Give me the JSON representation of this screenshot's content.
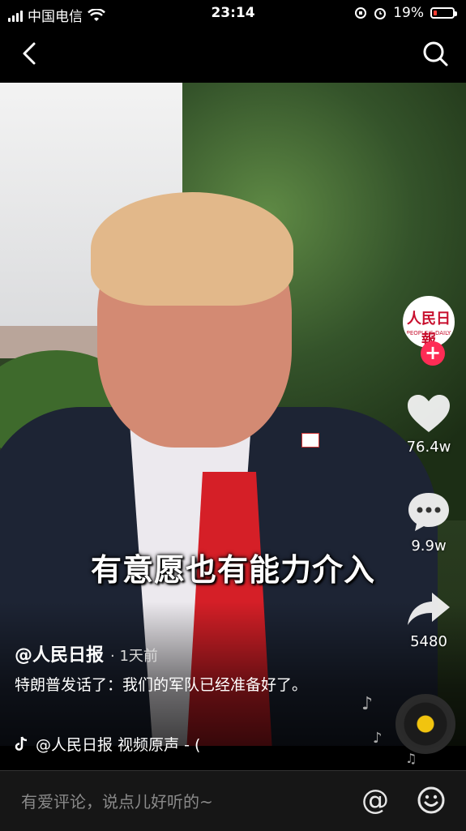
{
  "status_bar": {
    "carrier": "中国电信",
    "time": "23:14",
    "battery_percent": "19%",
    "battery_level": 0.19,
    "icons": [
      "signal-icon",
      "wifi-icon",
      "orientation-lock-icon",
      "alarm-icon",
      "battery-icon"
    ]
  },
  "nav": {
    "back_icon": "chevron-left-icon",
    "search_icon": "search-icon"
  },
  "video": {
    "subtitle": "有意愿也有能力介入"
  },
  "side_rail": {
    "avatar_logo_cn": "人民日報",
    "avatar_logo_en": "PEOPLE'S DAILY",
    "follow_symbol": "+",
    "likes": "76.4w",
    "comments": "9.9w",
    "shares": "5480"
  },
  "post": {
    "author": "@人民日报",
    "time_ago": "· 1天前",
    "caption": "特朗普发话了：我们的军队已经准备好了。",
    "music": "@人民日报    视频原声 - ("
  },
  "comment_bar": {
    "placeholder": "有爱评论，说点儿好听的~",
    "at_symbol": "@"
  },
  "colors": {
    "accent": "#fe2c55",
    "background": "#000000",
    "battery_low": "#ff3b30"
  }
}
